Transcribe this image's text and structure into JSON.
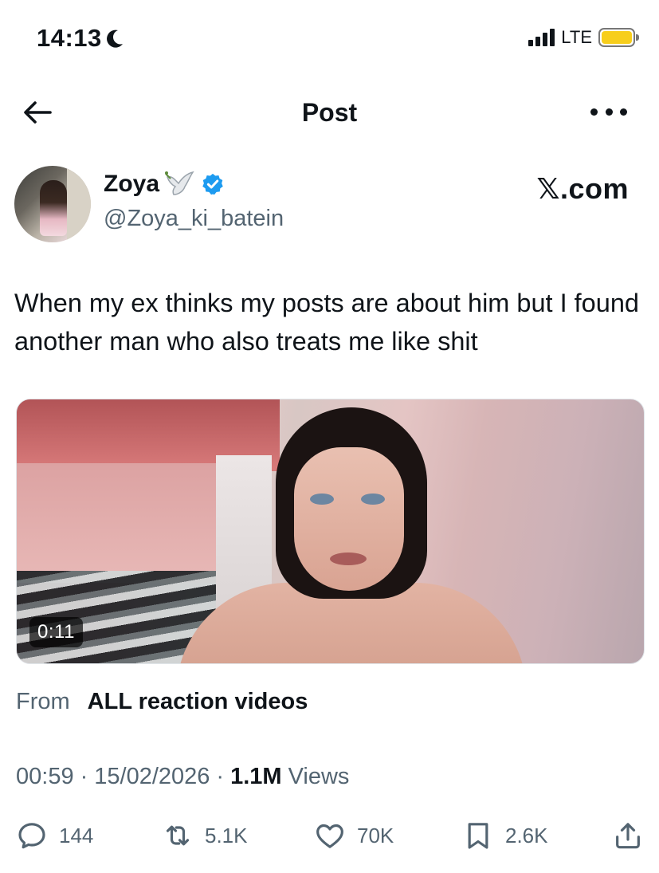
{
  "status_bar": {
    "time": "14:13",
    "network": "LTE",
    "battery_color": "#f7ce1c"
  },
  "header": {
    "title": "Post"
  },
  "author": {
    "name": "Zoya",
    "handle": "@Zoya_ki_batein",
    "verified": true,
    "verified_color": "#1d9bf0",
    "name_emoji": "dove"
  },
  "brand": "𝕏.com",
  "tweet": {
    "text": "When my ex thinks my posts are about him but I found another man who also treats me like shit"
  },
  "video": {
    "duration": "0:11"
  },
  "source": {
    "from_label": "From",
    "source_name": "ALL reaction videos"
  },
  "meta": {
    "time": "00:59",
    "separator": "·",
    "date": "15/02/2026",
    "views_count": "1.1M",
    "views_label": "Views"
  },
  "actions": {
    "replies": "144",
    "reposts": "5.1K",
    "likes": "70K",
    "bookmarks": "2.6K"
  }
}
